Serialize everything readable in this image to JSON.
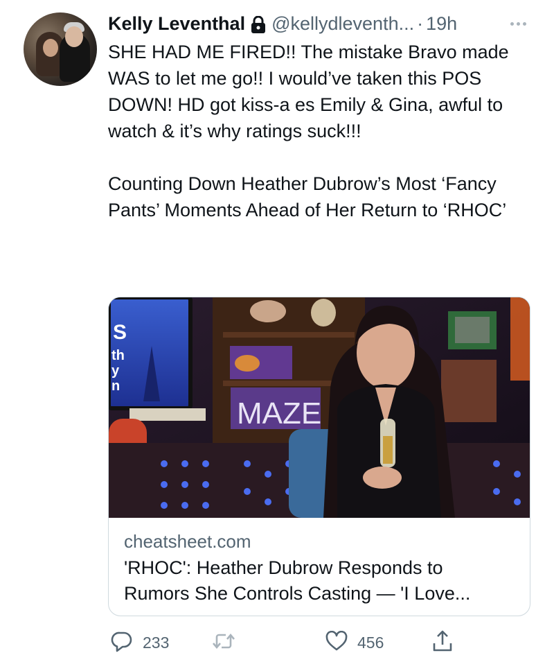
{
  "user": {
    "display_name": "Kelly Leventhal",
    "handle": "@kellydleventh...",
    "separator": "·",
    "time": "19h",
    "protected_icon": "lock-icon"
  },
  "tweet": {
    "paragraphs": [
      "SHE HAD ME FIRED!! The mistake Bravo made WAS to let me go!! I would’ve taken this POS DOWN! HD got kiss-a    es Emily & Gina, awful to watch & it’s why ratings suck!!!",
      "Counting Down Heather Dubrow’s Most ‘Fancy Pants’ Moments Ahead of Her Return to ‘RHOC’"
    ]
  },
  "card": {
    "domain": "cheatsheet.com",
    "title_line1": "'RHOC': Heather Dubrow Responds to",
    "title_line2": "Rumors She Controls Casting — 'I Love...",
    "image_sign_text": "MAZE"
  },
  "actions": {
    "reply_count": "233",
    "retweet_count": "",
    "like_count": "456"
  },
  "colors": {
    "text": "#0f1419",
    "secondary": "#536471",
    "border": "#cfd9de"
  }
}
